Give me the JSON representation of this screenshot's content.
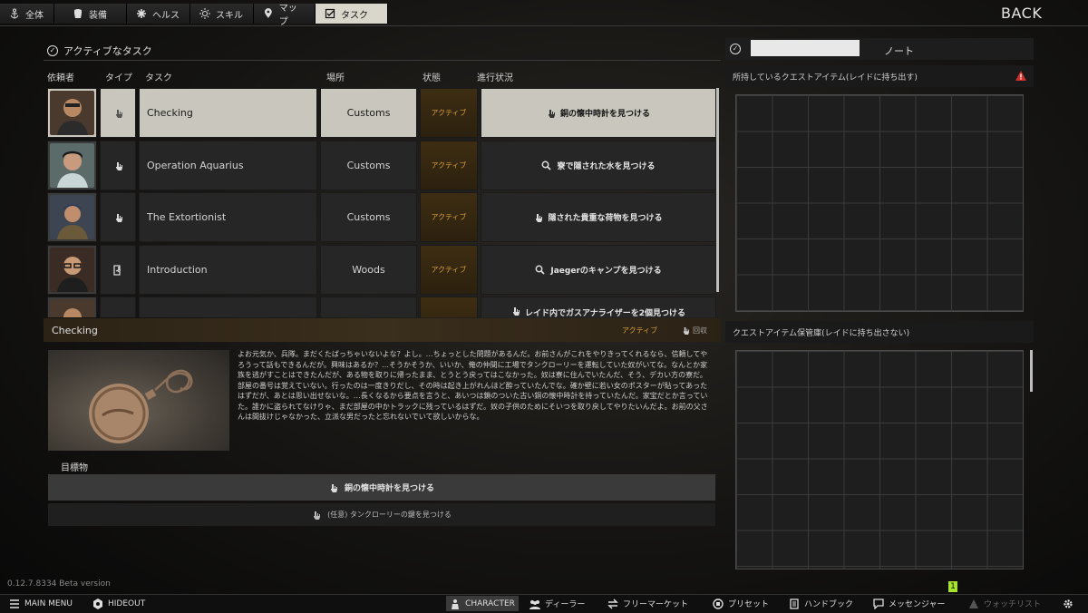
{
  "top_tabs": [
    {
      "label": "全体",
      "icon": "anchor-icon",
      "active": false
    },
    {
      "label": "装備",
      "icon": "armor-icon",
      "active": false
    },
    {
      "label": "ヘルス",
      "icon": "health-icon",
      "active": false
    },
    {
      "label": "スキル",
      "icon": "skill-icon",
      "active": false
    },
    {
      "label": "マップ",
      "icon": "map-pin-icon",
      "active": false
    },
    {
      "label": "タスク",
      "icon": "task-icon",
      "active": true
    }
  ],
  "back_label": "BACK",
  "tasks_section": {
    "title": "アクティブなタスク"
  },
  "columns": {
    "giver": "依頼者",
    "type": "タイプ",
    "task": "タスク",
    "location": "場所",
    "status": "状態",
    "progress": "進行状況"
  },
  "tasks": [
    {
      "name": "Checking",
      "location": "Customs",
      "status": "アクティブ",
      "progress": "銅の懐中時計を見つける",
      "type_icon": "hand-icon",
      "progress_icon": "hand-icon",
      "selected": true
    },
    {
      "name": "Operation Aquarius",
      "location": "Customs",
      "status": "アクティブ",
      "progress": "寮で隠された水を見つける",
      "type_icon": "hand-icon",
      "progress_icon": "search-icon",
      "selected": false
    },
    {
      "name": "The Extortionist",
      "location": "Customs",
      "status": "アクティブ",
      "progress": "隠された貴重な荷物を見つける",
      "type_icon": "hand-icon",
      "progress_icon": "hand-icon",
      "selected": false
    },
    {
      "name": "Introduction",
      "location": "Woods",
      "status": "アクティブ",
      "progress": "Jaegerのキャンプを見つける",
      "type_icon": "exit-icon",
      "progress_icon": "search-icon",
      "selected": false
    },
    {
      "name": "",
      "location": "",
      "status": "",
      "progress": "レイド内でガスアナライザーを2個見つける",
      "type_icon": "hand-icon",
      "progress_icon": "hand-icon",
      "selected": false
    }
  ],
  "detail": {
    "title": "Checking",
    "status": "アクティブ",
    "turn_in": "回収",
    "description": "よお元気か、兵隊。まだくたばっちゃいないよな？よし。…ちょっとした問題があるんだ。お前さんがこれをやりきってくれるなら、信頼してやろうって話もできるんだが。興味はあるか？…そうかそうか、いいか、俺の仲間に工場でタンクローリーを運転していた奴がいてな。なんとか家族を逃がすことはできたんだが、ある物を取りに帰ったまま、とうとう戻ってはこなかった。奴は寮に住んでいたんだ、そう、デカい方の寮だ。部屋の番号は覚えていない。行ったのは一度きりだし、その時は起き上がれんほど酔っていたんでな。確か壁に若い女のポスターが貼ってあったはずだが、あとは思い出せないな。…長くなるから要点を言うと、あいつは鎖のついた古い銅の懐中時計を持っていたんだ。家宝だとか言っていた。誰かに盗られてなけりゃ、まだ部屋の中かトラックに残っているはずだ。奴の子供のためにそいつを取り戻してやりたいんだよ。お前の父さんは間抜けじゃなかった、立派な男だったと忘れないでいて欲しいからな。",
    "objectives_label": "目標物",
    "objectives": [
      {
        "text": "銅の懐中時計を見つける"
      },
      {
        "text": "(任意) タンクローリーの鍵を見つける"
      }
    ]
  },
  "right_panel": {
    "note_tab": "ノート",
    "quest_items_header": "所持しているクエストアイテム(レイドに持ち出す)",
    "stash_header": "クエストアイテム保管庫(レイドに持ち出さない)"
  },
  "version": "0.12.7.8334 Beta version",
  "counter": "1",
  "bottom_bar": {
    "main_menu": "MAIN MENU",
    "hideout": "HIDEOUT",
    "character": "CHARACTER",
    "traders": "ディーラー",
    "flea_market": "フリーマーケット",
    "builds": "プリセット",
    "handbook": "ハンドブック",
    "messenger": "メッセンジャー",
    "watchlist": "ウォッチリスト"
  },
  "colors": {
    "accent_orange": "#d79d3b",
    "selected_row": "#c9c6bd",
    "warning_red": "#d0302a"
  }
}
